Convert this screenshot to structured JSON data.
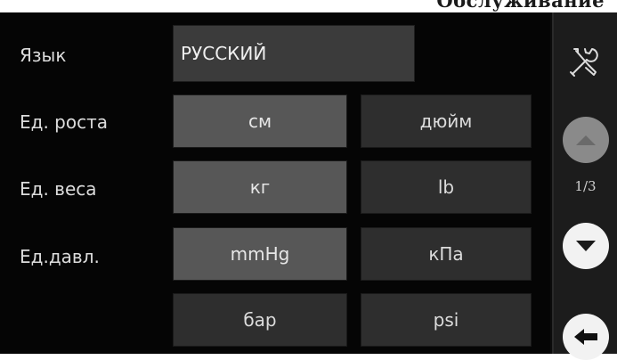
{
  "header": {
    "title_fragment": "Обслуживание"
  },
  "language": {
    "label": "Язык",
    "value": "РУССКИЙ"
  },
  "height_units": {
    "label": "Ед. роста",
    "options": [
      "см",
      "дюйм"
    ],
    "selected": "см"
  },
  "weight_units": {
    "label": "Ед. веса",
    "options": [
      "кг",
      "lb"
    ],
    "selected": "кг"
  },
  "pressure_units": {
    "label": "Ед.давл.",
    "options": [
      "mmHg",
      "кПа",
      "бар",
      "psi"
    ],
    "selected": "mmHg"
  },
  "sidebar": {
    "settings_icon": "wrench-screwdriver-icon",
    "page_indicator": "1/3",
    "scroll_up_icon": "triangle-up-icon",
    "scroll_down_icon": "triangle-down-icon",
    "back_icon": "arrow-left-icon"
  },
  "colors": {
    "screen_bg": "#050505",
    "button_bg": "#2e2e2e",
    "selected_bg": "#575757",
    "text": "#dcdcdc"
  }
}
